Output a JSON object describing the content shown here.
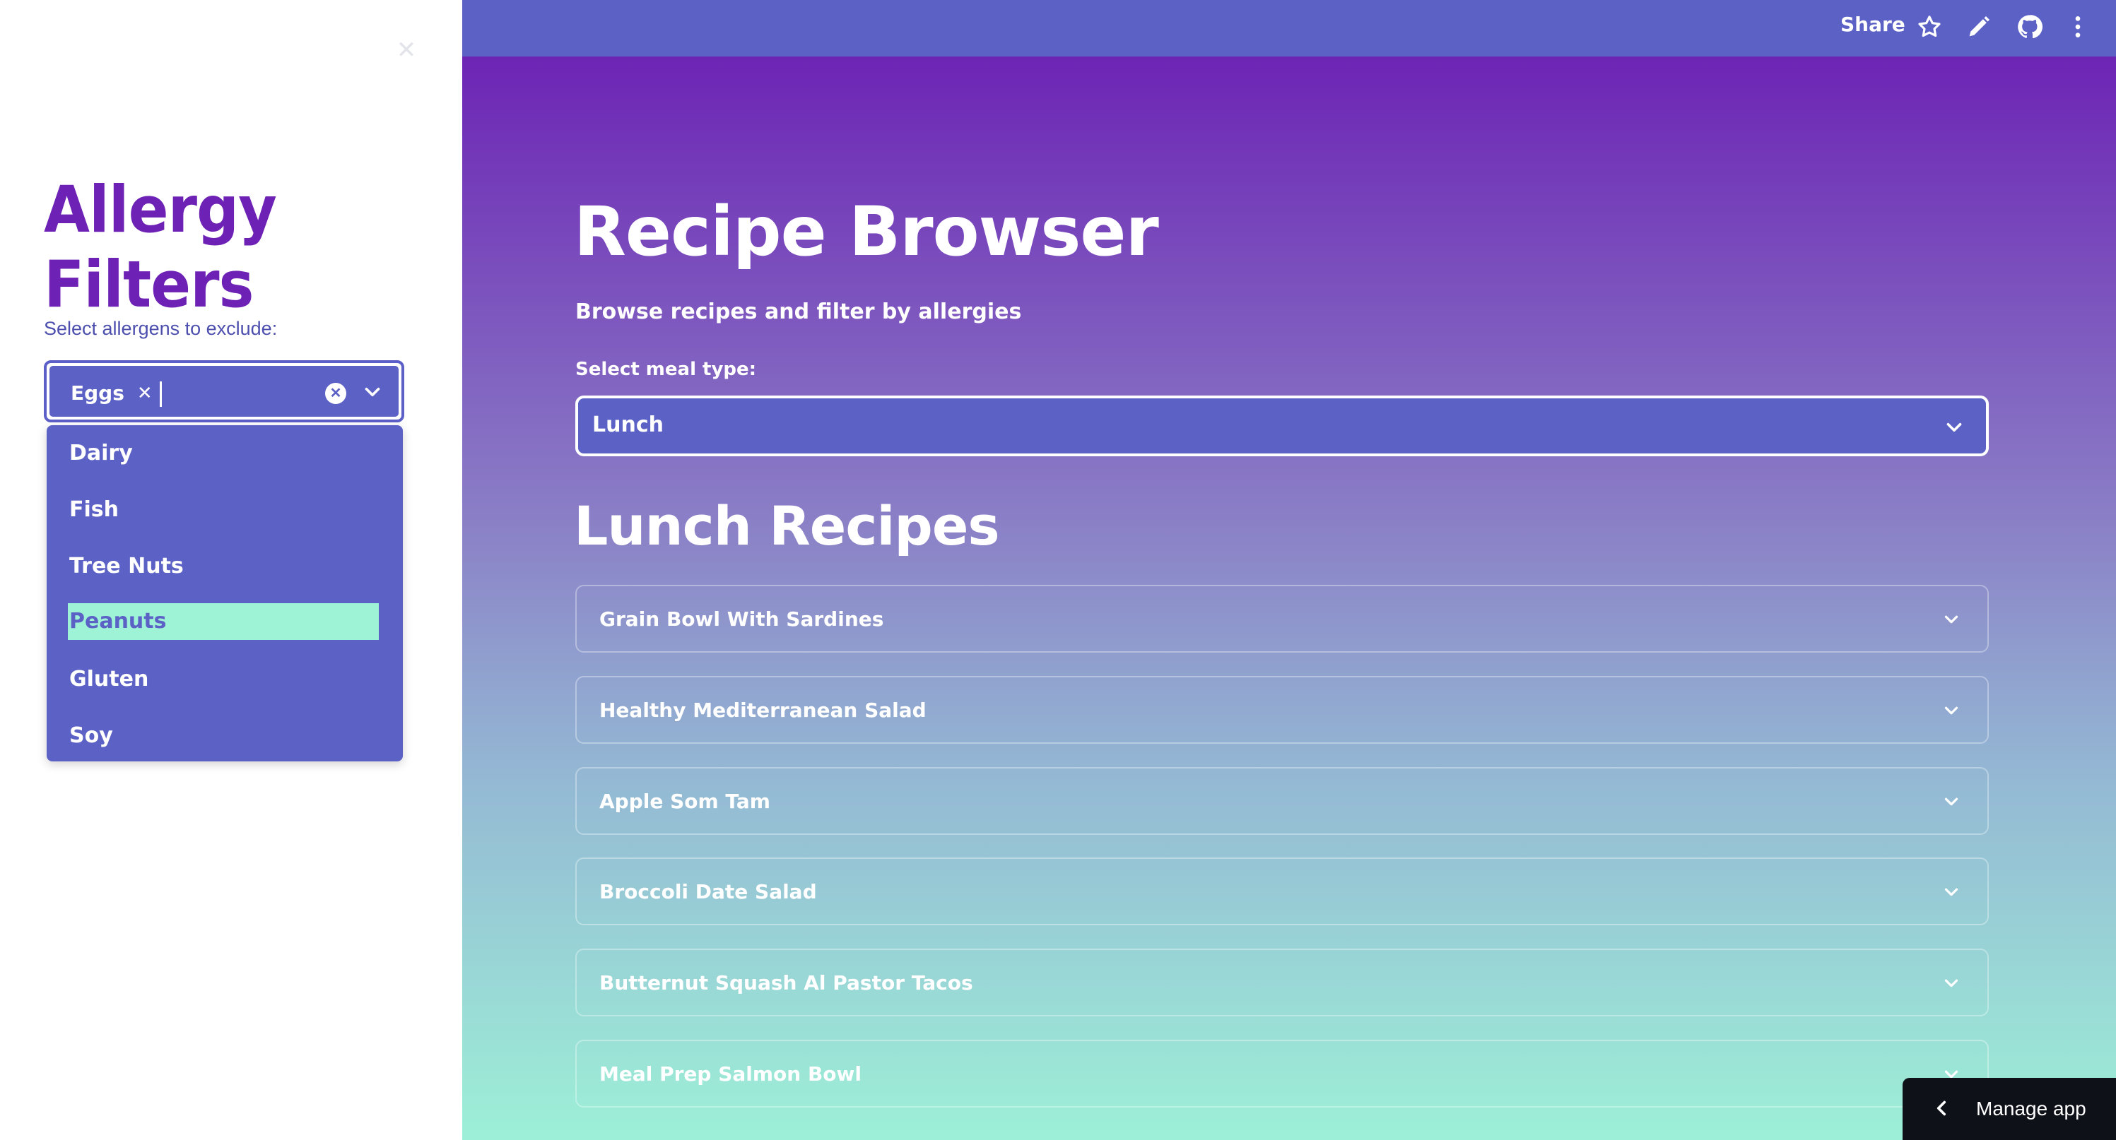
{
  "sidebar": {
    "title": "Allergy Filters",
    "select_label": "Select allergens to exclude:",
    "selected_chips": [
      "Eggs"
    ],
    "chip_remove_glyph": "✕",
    "clear_glyph": "✕",
    "close_glyph": "✕",
    "options": [
      "Dairy",
      "Fish",
      "Tree Nuts",
      "Peanuts",
      "Gluten",
      "Soy"
    ],
    "highlighted_option": "Peanuts"
  },
  "topbar": {
    "share_label": "Share",
    "icons": [
      "star-icon",
      "pencil-icon",
      "github-icon",
      "more-vertical-icon"
    ]
  },
  "main": {
    "title": "Recipe Browser",
    "subtitle": "Browse recipes and filter by allergies",
    "meal_label": "Select meal type:",
    "meal_value": "Lunch",
    "section_title": "Lunch Recipes",
    "recipes": [
      "Grain Bowl With Sardines",
      "Healthy Mediterranean Salad",
      "Apple Som Tam",
      "Broccoli Date Salad",
      "Butternut Squash Al Pastor Tacos",
      "Meal Prep Salmon Bowl"
    ]
  },
  "manage_app": {
    "label": "Manage app"
  },
  "colors": {
    "accent": "#5c61c6",
    "title_purple": "#6d22b5",
    "highlight": "#9ef3d7",
    "gradient_top": "#6c22b4",
    "gradient_bottom": "#9df0d7"
  }
}
